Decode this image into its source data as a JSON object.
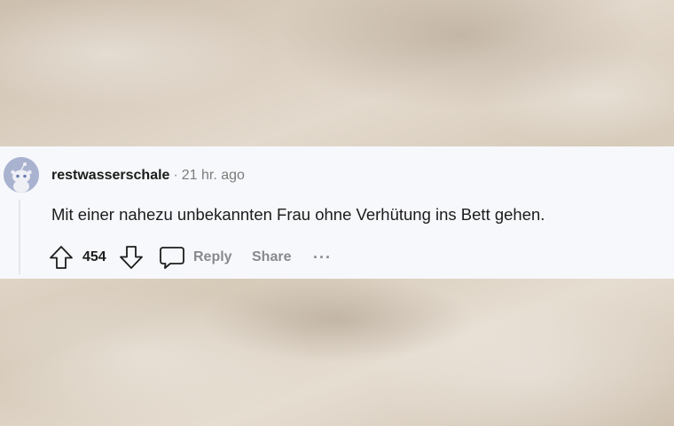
{
  "comment": {
    "username": "restwasserschale",
    "separator": "·",
    "timestamp": "21 hr. ago",
    "body": "Mit einer nahezu unbekannten Frau ohne Verhütung ins Bett gehen.",
    "score": "454"
  },
  "actions": {
    "reply_label": "Reply",
    "share_label": "Share",
    "more_label": "···"
  },
  "icons": {
    "upvote": "upvote-arrow-icon",
    "downvote": "downvote-arrow-icon",
    "reply": "speech-bubble-icon",
    "avatar": "snoo-avatar-icon"
  },
  "colors": {
    "card_bg": "#f7f8fb",
    "avatar_bg": "#a9b2cf",
    "text_dark": "#1c1c1c",
    "text_muted": "#878a8c"
  }
}
